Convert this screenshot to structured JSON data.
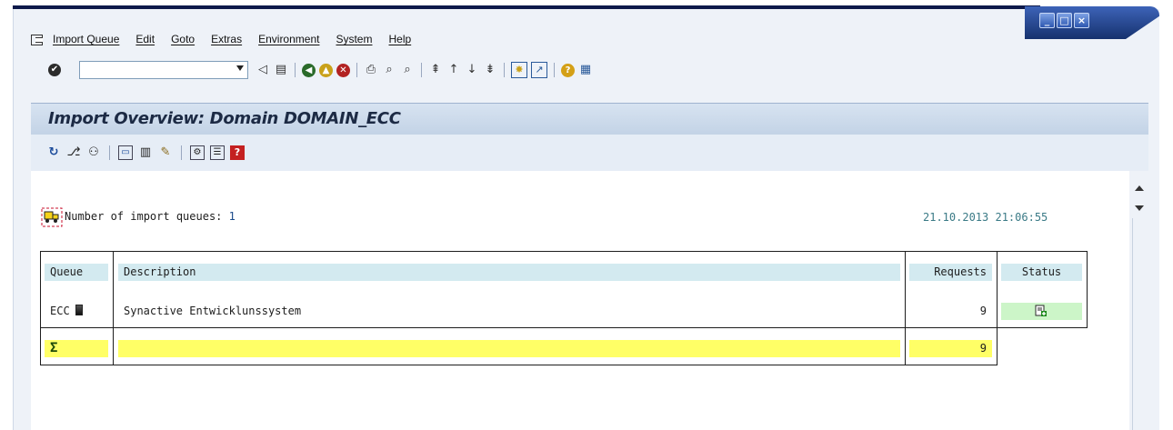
{
  "window": {
    "buttons": [
      "minimize",
      "maximize",
      "close"
    ]
  },
  "menu": {
    "items": [
      "Import Queue",
      "Edit",
      "Goto",
      "Extras",
      "Environment",
      "System",
      "Help"
    ]
  },
  "command_field": {
    "value": ""
  },
  "title": "Import Overview: Domain DOMAIN_ECC",
  "summary": {
    "label": "Number of import queues:",
    "count": "1",
    "timestamp": "21.10.2013 21:06:55"
  },
  "table": {
    "headers": {
      "queue": "Queue",
      "description": "Description",
      "requests": "Requests",
      "status": "Status"
    },
    "rows": [
      {
        "queue": "ECC",
        "description": "Synactive Entwicklunssystem",
        "requests": "9"
      }
    ],
    "total": {
      "symbol": "Σ",
      "requests": "9"
    }
  },
  "colors": {
    "header_cell": "#d3eaf0",
    "total_row": "#ffff66",
    "status_ok": "#ccf5c8",
    "title_band": "#c3d3e6"
  }
}
